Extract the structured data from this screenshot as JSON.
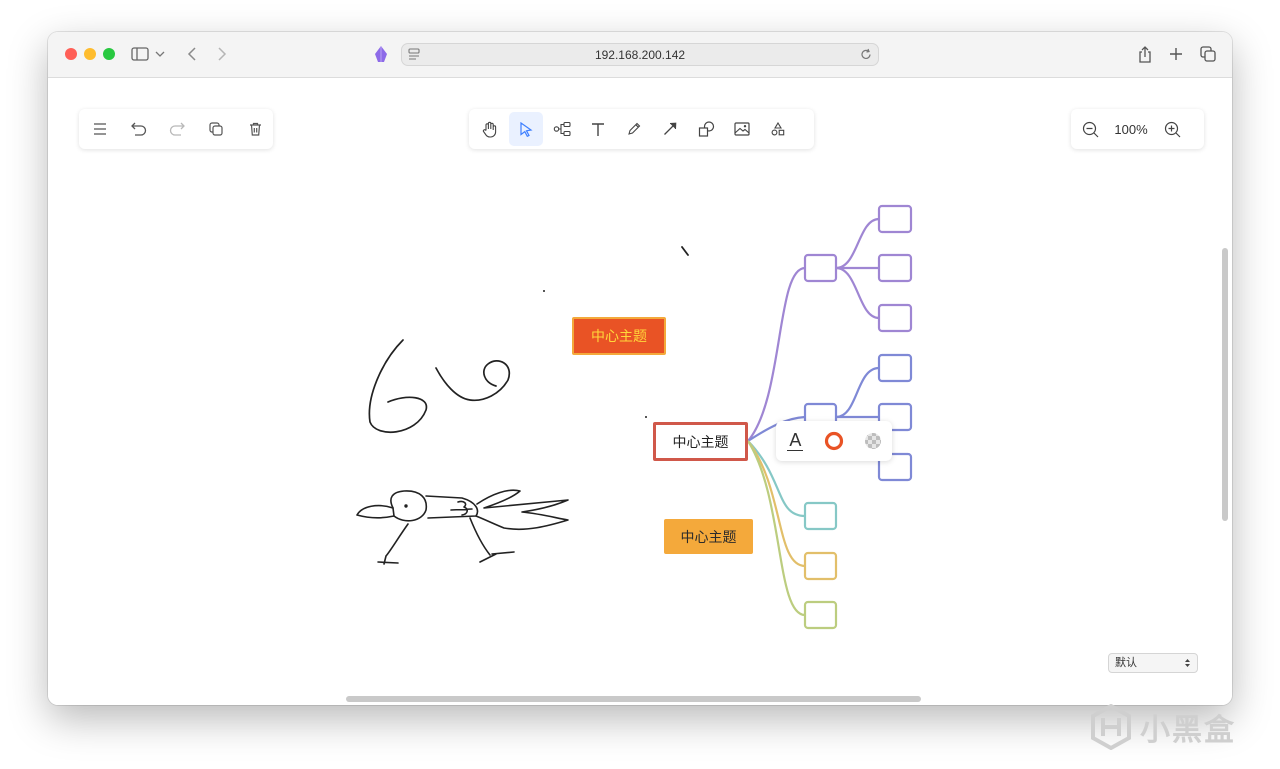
{
  "browser": {
    "url": "192.168.200.142"
  },
  "canvas": {
    "zoom_level": "100%",
    "nodes": {
      "red_topic": "中心主题",
      "center_topic": "中心主题",
      "orange_topic": "中心主题"
    },
    "popover": {
      "text_glyph": "A"
    },
    "theme_select": {
      "value": "默认"
    }
  },
  "colors": {
    "red_node_fill": "#e95325",
    "red_node_text": "#ffd83a",
    "orange_node_fill": "#f4a93b",
    "center_border": "#d0584a",
    "branch_purple": "#9f86d3",
    "branch_indigo": "#7f89d6",
    "branch_teal": "#86c8c6",
    "branch_yellow": "#e2bf6a",
    "branch_olive": "#bccd7f",
    "accent_blue": "#3d7fff"
  },
  "watermark": {
    "text": "小黑盒"
  }
}
